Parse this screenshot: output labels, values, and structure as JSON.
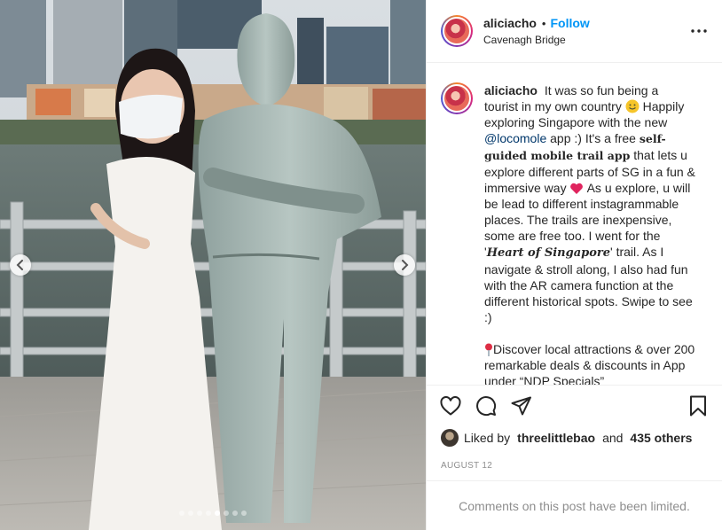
{
  "media": {
    "carousel": {
      "total_slides": 8,
      "active_index": 4
    }
  },
  "header": {
    "username": "aliciacho",
    "separator": "•",
    "follow_label": "Follow",
    "location": "Cavenagh Bridge",
    "more_icon": "more-horizontal-icon"
  },
  "caption": {
    "username": "aliciacho",
    "text_1": "It was so fun being a tourist in my own country",
    "text_2": "Happily exploring Singapore with the new",
    "mention": "@locomole",
    "text_3": "app :) It's a free",
    "bold_phrase": "self-guided mobile trail app",
    "text_4": "that lets u explore different parts of SG in a fun & immersive way",
    "text_5": "As u explore, u will be lead to different instagrammable places. The trails are inexpensive, some are free too. I went for the '",
    "italic_phrase": "Heart of Singapore",
    "text_6": "' trail. As I navigate & stroll along, I also had fun with the AR camera function at the different historical spots. Swipe to see :)",
    "para2": "Discover local attractions & over 200 remarkable deals & discounts in App under “NDP Specials”",
    "emoji_1": "smiling-face-icon",
    "emoji_2": "red-heart-icon",
    "emoji_3": "round-pushpin-icon"
  },
  "actions": {
    "like_icon": "heart-icon",
    "comment_icon": "comment-icon",
    "share_icon": "paper-plane-icon",
    "save_icon": "bookmark-icon"
  },
  "likes": {
    "prefix": "Liked by",
    "liker": "threelittlebao",
    "and": "and",
    "others": "435 others"
  },
  "date": "AUGUST 12",
  "comments_limited": "Comments on this post have been limited.",
  "colors": {
    "link_blue": "#0095f6",
    "mention_blue": "#00376b",
    "muted_gray": "#8e8e8e",
    "divider": "#efefef"
  }
}
